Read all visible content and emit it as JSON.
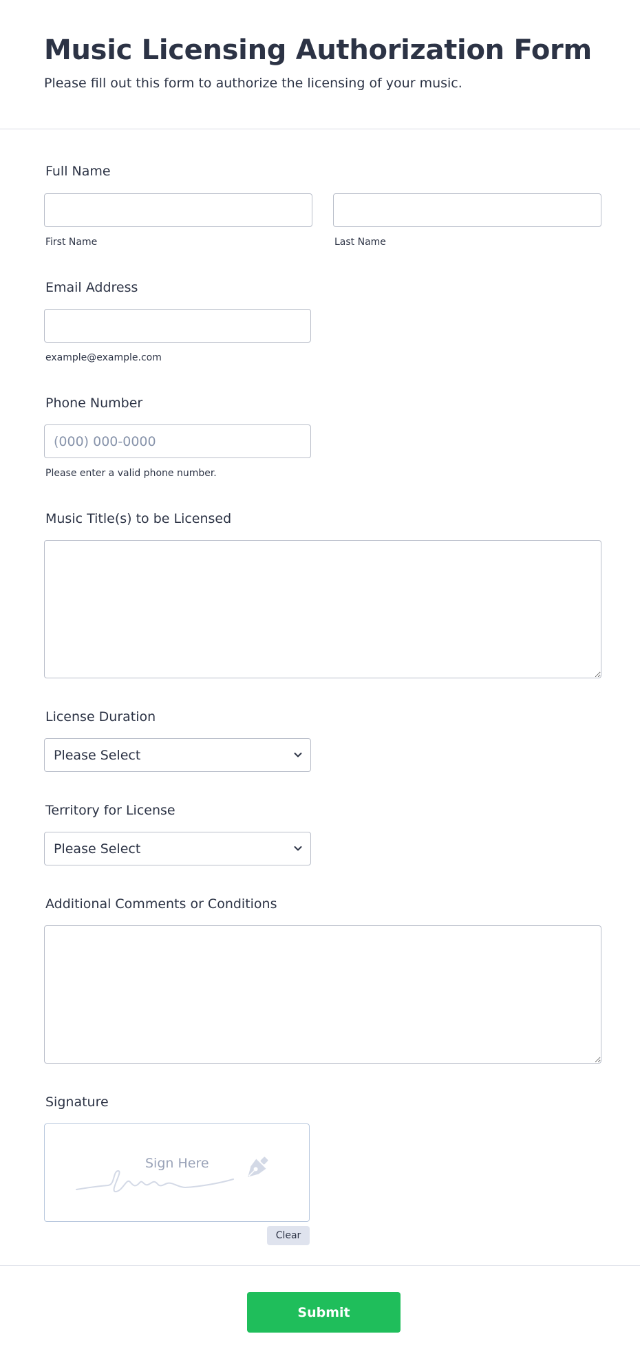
{
  "form": {
    "title": "Music Licensing Authorization Form",
    "subtitle": "Please fill out this form to authorize the licensing of your music."
  },
  "full_name": {
    "label": "Full Name",
    "first_sublabel": "First Name",
    "last_sublabel": "Last Name",
    "first_value": "",
    "last_value": ""
  },
  "email": {
    "label": "Email Address",
    "value": "",
    "sublabel": "example@example.com"
  },
  "phone": {
    "label": "Phone Number",
    "placeholder": "(000) 000-0000",
    "sublabel": "Please enter a valid phone number."
  },
  "music_titles": {
    "label": "Music Title(s) to be Licensed",
    "value": ""
  },
  "license_duration": {
    "label": "License Duration",
    "selected": "Please Select"
  },
  "territory": {
    "label": "Territory for License",
    "selected": "Please Select"
  },
  "comments": {
    "label": "Additional Comments or Conditions",
    "value": ""
  },
  "signature": {
    "label": "Signature",
    "pad_text": "Sign Here",
    "clear_label": "Clear"
  },
  "submit_label": "Submit",
  "colors": {
    "accent": "#1fbe5b",
    "text": "#2c3345",
    "border": "#b8bdc9"
  }
}
